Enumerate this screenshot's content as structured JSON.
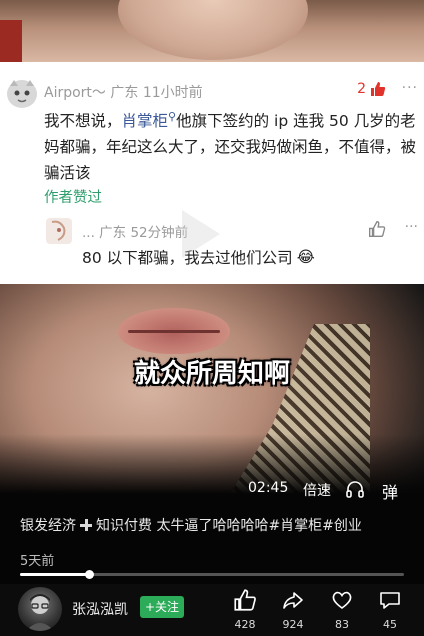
{
  "comment": {
    "username": "Airport～",
    "location_time": "广东 11小时前",
    "like_count": "2",
    "text_before_link": "我不想说，",
    "link_text": "肖掌柜",
    "text_after_link": "他旗下签约的 ip 连我 50 几岁的老妈都骗，年纪这么大了，还交我妈做闲鱼，不值得，被骗活该",
    "author_liked_label": "作者赞过"
  },
  "reply": {
    "meta": "... 广东 52分钟前",
    "text": "80 以下都骗，我去过他们公司",
    "emoji": "😂"
  },
  "video": {
    "subtitle": "就众所周知啊",
    "time": "02:45",
    "speed_label": "倍速",
    "danmu_label": "弹",
    "progress_fraction": 0.18
  },
  "description": {
    "tag1": "银发经济",
    "tag2": "知识付费",
    "rest": "太牛逼了哈哈哈哈#肖掌柜#创业",
    "date": "5天前"
  },
  "bottom": {
    "author_name": "张泓泓凯",
    "follow_label": "+关注",
    "likes": "428",
    "shares": "924",
    "favorites": "83",
    "comments": "45"
  },
  "colors": {
    "like_red": "#e2322c",
    "link_blue": "#3b5998",
    "author_liked_green": "#2f9e6e",
    "follow_green": "#2cab58"
  },
  "icons": [
    "airport-avatar-icon",
    "thumb-up-filled-icon",
    "more-icon",
    "thumb-up-icon",
    "headphone-icon",
    "like-icon",
    "share-icon",
    "star-icon",
    "comment-icon"
  ]
}
